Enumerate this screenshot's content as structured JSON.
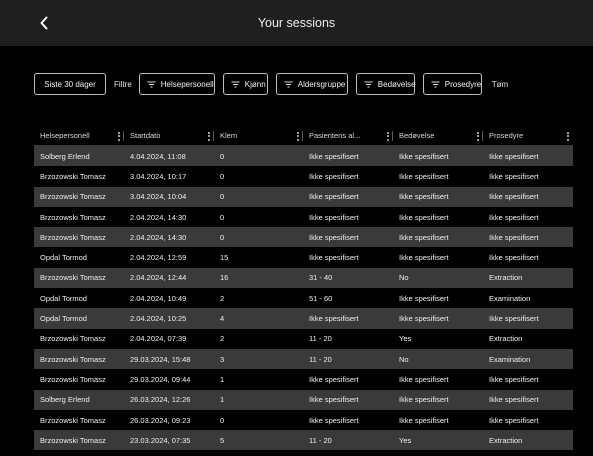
{
  "header": {
    "title": "Your sessions",
    "back_icon": "chevron-left-icon"
  },
  "filters": {
    "period_label": "Siste 30 dager",
    "label": "Filtre",
    "chips": [
      {
        "label": "Helsepersonell",
        "icon": "filter-lines-icon"
      },
      {
        "label": "Kjønn",
        "icon": "filter-lines-icon"
      },
      {
        "label": "Aldersgruppe",
        "icon": "filter-lines-icon"
      },
      {
        "label": "Bedøvelse",
        "icon": "filter-lines-icon"
      },
      {
        "label": "Prosedyre",
        "icon": "filter-lines-icon"
      }
    ],
    "clear_label": "Tøm"
  },
  "table": {
    "columns": [
      "Helsepersonell",
      "Startdato",
      "Klem",
      "Pasientens al...",
      "Bedøvelse",
      "Prosedyre"
    ],
    "rows": [
      [
        "Solberg Erlend",
        "4.04.2024, 11:08",
        "0",
        "Ikke spesifisert",
        "Ikke spesifisert",
        "Ikke spesifisert"
      ],
      [
        "Brzozowski Tomasz",
        "3.04.2024, 10:17",
        "0",
        "Ikke spesifisert",
        "Ikke spesifisert",
        "Ikke spesifisert"
      ],
      [
        "Brzozowski Tomasz",
        "3.04.2024, 10:04",
        "0",
        "Ikke spesifisert",
        "Ikke spesifisert",
        "Ikke spesifisert"
      ],
      [
        "Brzozowski Tomasz",
        "2.04.2024, 14:30",
        "0",
        "Ikke spesifisert",
        "Ikke spesifisert",
        "Ikke spesifisert"
      ],
      [
        "Brzozowski Tomasz",
        "2.04.2024, 14:30",
        "0",
        "Ikke spesifisert",
        "Ikke spesifisert",
        "Ikke spesifisert"
      ],
      [
        "Opdal Tormod",
        "2.04.2024, 12:59",
        "15",
        "Ikke spesifisert",
        "Ikke spesifisert",
        "Ikke spesifisert"
      ],
      [
        "Brzozowski Tomasz",
        "2.04.2024, 12:44",
        "16",
        "31 - 40",
        "No",
        "Extraction"
      ],
      [
        "Opdal Tormod",
        "2.04.2024, 10:49",
        "2",
        "51 - 60",
        "Ikke spesifisert",
        "Examination"
      ],
      [
        "Opdal Tormod",
        "2.04.2024, 10:25",
        "4",
        "Ikke spesifisert",
        "Ikke spesifisert",
        "Ikke spesifisert"
      ],
      [
        "Brzozowski Tomasz",
        "2.04.2024, 07:39",
        "2",
        "11 - 20",
        "Yes",
        "Extraction"
      ],
      [
        "Brzozowski Tomasz",
        "29.03.2024, 15:48",
        "3",
        "11 - 20",
        "No",
        "Examination"
      ],
      [
        "Brzozowski Tomasz",
        "29.03.2024, 09:44",
        "1",
        "Ikke spesifisert",
        "Ikke spesifisert",
        "Ikke spesifisert"
      ],
      [
        "Solberg Erlend",
        "26.03.2024, 12:26",
        "1",
        "Ikke spesifisert",
        "Ikke spesifisert",
        "Ikke spesifisert"
      ],
      [
        "Brzozowski Tomasz",
        "26.03.2024, 09:23",
        "0",
        "Ikke spesifisert",
        "Ikke spesifisert",
        "Ikke spesifisert"
      ],
      [
        "Brzozowski Tomasz",
        "23.03.2024, 07:35",
        "5",
        "11 - 20",
        "Yes",
        "Extraction"
      ]
    ]
  },
  "colors": {
    "background": "#000000",
    "topbar": "#1f1f1f",
    "row_alt": "#3a3a3a"
  }
}
